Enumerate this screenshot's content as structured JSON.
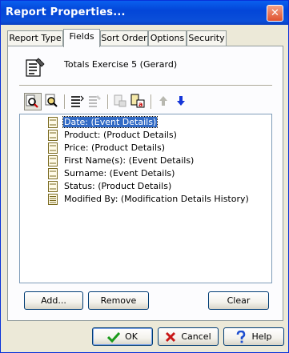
{
  "window": {
    "title": "Report Properties...",
    "close_symbol": "✕"
  },
  "tabs": [
    {
      "label": "Report Type",
      "active": false
    },
    {
      "label": "Fields",
      "active": true
    },
    {
      "label": "Sort Order",
      "active": false
    },
    {
      "label": "Options",
      "active": false
    },
    {
      "label": "Security",
      "active": false
    }
  ],
  "report": {
    "name": "Totals Exercise 5 (Gerard)",
    "icon": "report-document-icon"
  },
  "toolbar": {
    "buttons": [
      {
        "icon": "field-search-icon",
        "pressed": true,
        "enabled": true
      },
      {
        "icon": "field-browse-icon",
        "pressed": false,
        "enabled": true
      },
      {
        "icon": "list-icon",
        "pressed": false,
        "enabled": true
      },
      {
        "icon": "list-edit-icon",
        "pressed": false,
        "enabled": false
      },
      {
        "icon": "rename-field-icon",
        "pressed": false,
        "enabled": false
      },
      {
        "icon": "field-properties-icon",
        "pressed": false,
        "enabled": true
      },
      {
        "icon": "move-up-icon",
        "pressed": false,
        "enabled": false
      },
      {
        "icon": "move-down-icon",
        "pressed": false,
        "enabled": true
      }
    ]
  },
  "fields": [
    {
      "label": "Date: (Event Details)",
      "selected": true,
      "icon": "field-icon"
    },
    {
      "label": "Product: (Product Details)",
      "selected": false,
      "icon": "field-icon"
    },
    {
      "label": "Price: (Product Details)",
      "selected": false,
      "icon": "field-icon"
    },
    {
      "label": "First Name(s): (Event Details)",
      "selected": false,
      "icon": "field-icon"
    },
    {
      "label": "Surname: (Event Details)",
      "selected": false,
      "icon": "field-icon"
    },
    {
      "label": "Status: (Product Details)",
      "selected": false,
      "icon": "field-icon"
    },
    {
      "label": "Modified By: (Modification Details History)",
      "selected": false,
      "icon": "history-field-icon"
    }
  ],
  "field_buttons": {
    "add": "Add...",
    "remove": "Remove",
    "clear": "Clear"
  },
  "dialog_buttons": {
    "ok": "OK",
    "cancel": "Cancel",
    "help": "Help"
  },
  "colors": {
    "titlebar": "#0a50dc",
    "selection": "#316ac5",
    "ok_check": "#1a9a1a",
    "cancel_x": "#c81818",
    "help_q": "#1e4fd0"
  }
}
